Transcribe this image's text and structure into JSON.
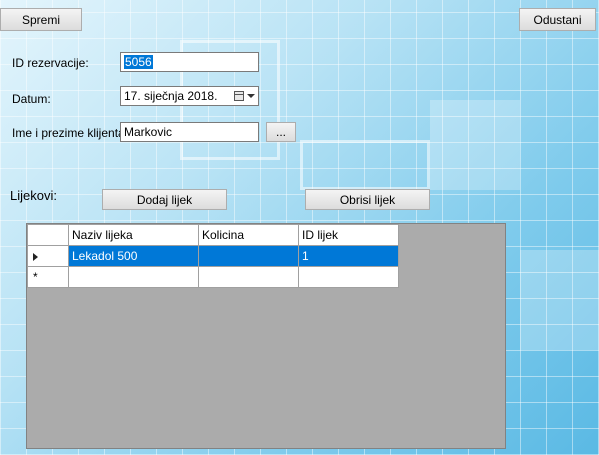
{
  "toolbar": {
    "save_label": "Spremi",
    "cancel_label": "Odustani"
  },
  "form": {
    "id_label": "ID rezervacije:",
    "id_value": "5056",
    "date_label": "Datum:",
    "date_value": "17.  siječnja   2018.",
    "client_label": "Ime i prezime klijenta:",
    "client_value": "Markovic",
    "browse_label": "..."
  },
  "medicines": {
    "section_label": "Lijekovi:",
    "add_label": "Dodaj lijek",
    "remove_label": "Obrisi lijek",
    "columns": [
      "Naziv lijeka",
      "Kolicina",
      "ID lijek"
    ],
    "rows": [
      {
        "naziv": "Lekadol 500",
        "kolicina": "",
        "id": "1"
      }
    ],
    "new_row_marker": "*"
  },
  "colors": {
    "selection": "#0078d7",
    "grid_background": "#ababab"
  },
  "icons": {
    "calendar": "calendar-icon",
    "dropdown": "chevron-down-icon",
    "current_row": "row-pointer-icon"
  }
}
